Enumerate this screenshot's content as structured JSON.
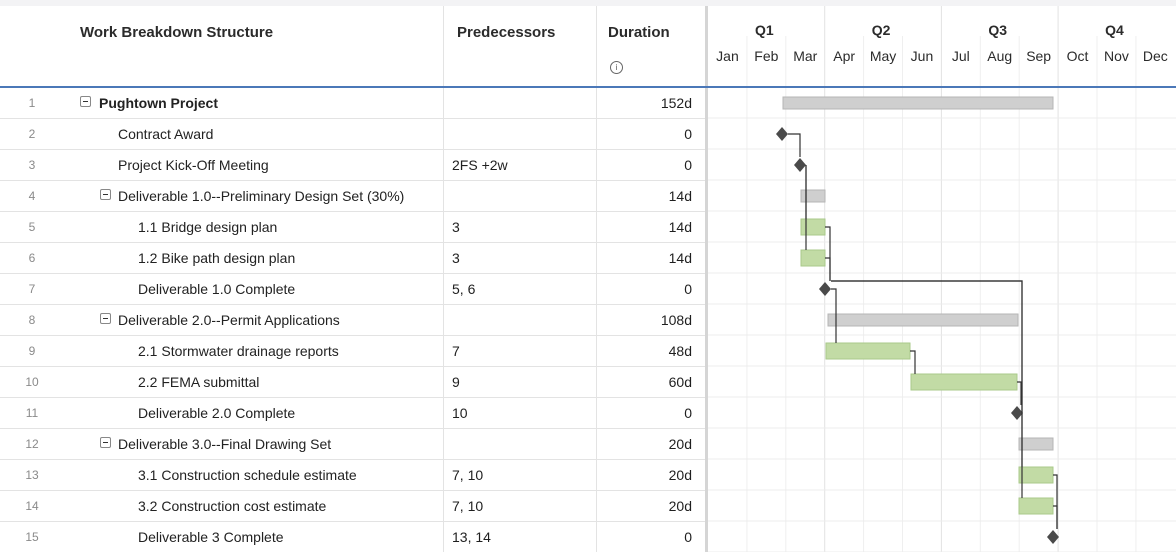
{
  "columns": {
    "wbs": "Work Breakdown Structure",
    "predecessors": "Predecessors",
    "duration": "Duration",
    "duration_info_icon": "info-icon"
  },
  "timeline": {
    "quarters": [
      "Q1",
      "Q2",
      "Q3",
      "Q4"
    ],
    "months": [
      "Jan",
      "Feb",
      "Mar",
      "Apr",
      "May",
      "Jun",
      "Jul",
      "Aug",
      "Sep",
      "Oct",
      "Nov",
      "Dec"
    ]
  },
  "colors": {
    "summary_bar": "#cfcfcf",
    "task_bar": "#c2dba5",
    "milestone": "#4a4a4a",
    "header_rule": "#4b78b8"
  },
  "rows": [
    {
      "num": "1",
      "name": "Pughtown Project",
      "pred": "",
      "dur": "152d"
    },
    {
      "num": "2",
      "name": "Contract Award",
      "pred": "",
      "dur": "0"
    },
    {
      "num": "3",
      "name": "Project Kick-Off Meeting",
      "pred": "2FS +2w",
      "dur": "0"
    },
    {
      "num": "4",
      "name": "Deliverable 1.0--Preliminary Design Set (30%)",
      "pred": "",
      "dur": "14d"
    },
    {
      "num": "5",
      "name": "1.1 Bridge design plan",
      "pred": "3",
      "dur": "14d"
    },
    {
      "num": "6",
      "name": "1.2 Bike path design plan",
      "pred": "3",
      "dur": "14d"
    },
    {
      "num": "7",
      "name": "Deliverable 1.0 Complete",
      "pred": "5, 6",
      "dur": "0"
    },
    {
      "num": "8",
      "name": "Deliverable 2.0--Permit Applications",
      "pred": "",
      "dur": "108d"
    },
    {
      "num": "9",
      "name": "2.1 Stormwater drainage reports",
      "pred": "7",
      "dur": "48d"
    },
    {
      "num": "10",
      "name": "2.2 FEMA submittal",
      "pred": "9",
      "dur": "60d"
    },
    {
      "num": "11",
      "name": "Deliverable 2.0 Complete",
      "pred": "10",
      "dur": "0"
    },
    {
      "num": "12",
      "name": "Deliverable 3.0--Final Drawing Set",
      "pred": "",
      "dur": "20d"
    },
    {
      "num": "13",
      "name": "3.1 Construction schedule estimate",
      "pred": "7, 10",
      "dur": "20d"
    },
    {
      "num": "14",
      "name": "3.2 Construction cost estimate",
      "pred": "7, 10",
      "dur": "20d"
    },
    {
      "num": "15",
      "name": "Deliverable 3 Complete",
      "pred": "13, 14",
      "dur": "0"
    }
  ]
}
